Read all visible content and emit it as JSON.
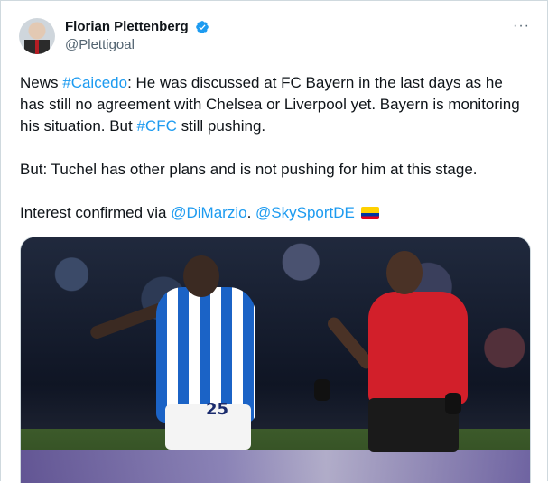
{
  "author": {
    "name": "Florian Plettenberg",
    "handle": "@Plettigoal",
    "avatar_icon": "avatar",
    "verified_icon": "verified-badge-icon"
  },
  "more_label": "···",
  "tweet": {
    "p1_prefix": "News ",
    "hashtag_caicedo": "#Caicedo",
    "p1_middle": ": He was discussed at FC Bayern in the last days as he has still no agreement with Chelsea or Liverpool yet. Bayern is monitoring his situation. But ",
    "hashtag_cfc": "#CFC",
    "p1_suffix": " still pushing.",
    "p2": "But: Tuchel has other plans and is not pushing for him at this stage.",
    "p3_prefix": "Interest confirmed via ",
    "mention_dimarzio": "@DiMarzio",
    "p3_sep": ". ",
    "mention_skysport": "@SkySportDE",
    "flag_icon": "ecuador-flag-icon"
  },
  "media": {
    "player_left_number": "25"
  },
  "colors": {
    "link": "#1d9bf0",
    "text": "#0f1419",
    "secondary": "#536471",
    "verified": "#1d9bf0"
  }
}
